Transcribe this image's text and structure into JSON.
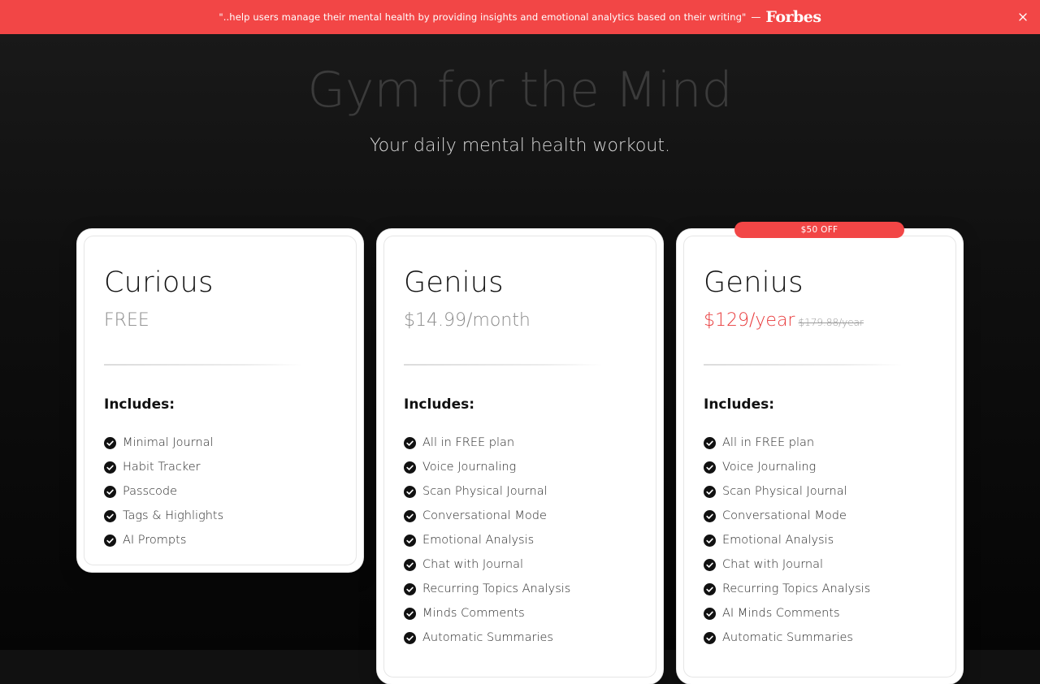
{
  "banner": {
    "quote": "\"..help users manage their mental health by providing insights and emotional analytics based on their writing\"",
    "dash": "—",
    "brand": "Forbes",
    "close_icon": "close-icon",
    "background_color": "#f24646"
  },
  "hero": {
    "title": "Gym for the Mind",
    "subtitle": "Your daily mental health workout."
  },
  "plans": [
    {
      "name": "Curious",
      "price": "FREE",
      "includes_label": "Includes:",
      "features": [
        "Minimal Journal",
        "Habit Tracker",
        "Passcode",
        "Tags & Highlights",
        "AI Prompts"
      ]
    },
    {
      "name": "Genius",
      "price": "$14.99/month",
      "includes_label": "Includes:",
      "features": [
        "All in FREE plan",
        "Voice Journaling",
        "Scan Physical Journal",
        "Conversational Mode",
        "Emotional Analysis",
        "Chat with Journal",
        "Recurring Topics Analysis",
        "Minds Comments",
        "Automatic Summaries"
      ]
    },
    {
      "name": "Genius",
      "badge": "$50 OFF",
      "price": "$129/year",
      "old_price": "$179.88/year",
      "price_color": "#e8393a",
      "includes_label": "Includes:",
      "features": [
        "All in FREE plan",
        "Voice Journaling",
        "Scan Physical Journal",
        "Conversational Mode",
        "Emotional Analysis",
        "Chat with Journal",
        "Recurring Topics Analysis",
        "AI Minds Comments",
        "Automatic Summaries"
      ]
    }
  ],
  "icons": {
    "feature_check": "check-circle-icon"
  }
}
